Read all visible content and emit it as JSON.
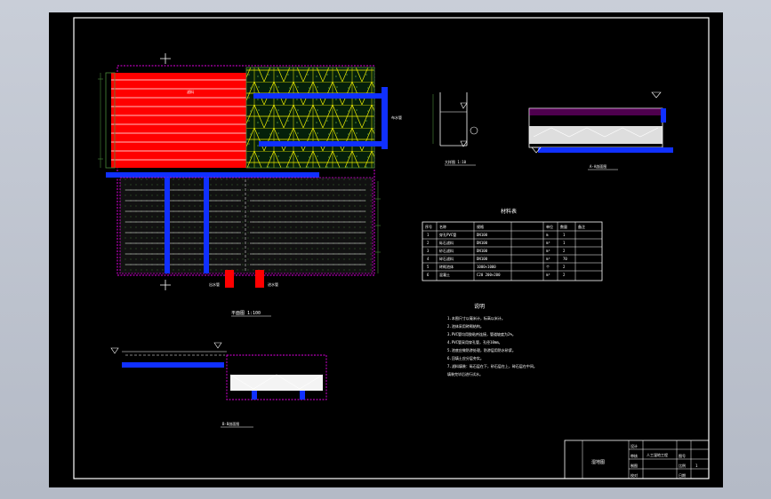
{
  "drawing": {
    "plan_caption": "平面图 1:100",
    "detail_caption": "大样图 1:10",
    "section_right_caption": "A-A剖面图",
    "section_bottom_caption": "B-B剖面图",
    "plan_labels": {
      "red_label": "滤料",
      "left_outlet": "出水管",
      "right_inlet": "进水管",
      "right_side": "布水管"
    },
    "table_title": "材料表",
    "table_headers": [
      "序号",
      "名称",
      "规格",
      "单位",
      "数量",
      "备注"
    ],
    "table_rows": [
      [
        "1",
        "穿孔PVC管",
        "DN100",
        "m",
        "1",
        ""
      ],
      [
        "2",
        "砾石滤料",
        "DN100",
        "m³",
        "1",
        ""
      ],
      [
        "3",
        "砂石滤料",
        "DN100",
        "m³",
        "2",
        ""
      ],
      [
        "4",
        "碎石滤料",
        "DN100",
        "m³",
        "70",
        ""
      ],
      [
        "5",
        "砖砌池体",
        "1000×1000",
        "个",
        "2",
        ""
      ],
      [
        "6",
        "混凝土",
        "C20 200×200",
        "m³",
        "2",
        ""
      ]
    ],
    "notes_title": "说明",
    "notes": [
      "1.本图尺寸以毫米计，标高以米计。",
      "2.池体采用砖砌结构。",
      "3.PVC管均用胶粘剂连接，管道坡度为2%。",
      "4.PVC管采用穿孔管，孔径10mm。",
      "5.池底应做防渗处理，防渗层用防水砂浆。",
      "6.回填土应分层夯实。",
      "7.滤料填装：砾石层在下，砂石层在上，碎石层在中间。",
      "  填装完毕后进行试水。"
    ],
    "title_block": {
      "drawing_name": "湿地图",
      "project": "人工湿地工程",
      "rows_left": [
        "设计",
        "审核",
        "制图",
        "校对"
      ],
      "rows_right": [
        "图号",
        "比例",
        "日期"
      ],
      "sheet": "1"
    }
  },
  "colors": {
    "frame": "#ffffff",
    "red_fill": "#ff0000",
    "blue_pipe": "#1030ff",
    "green_mesh": "#4a8a3a",
    "yellow_line": "#f0f000",
    "magenta_border": "#e000e0"
  }
}
